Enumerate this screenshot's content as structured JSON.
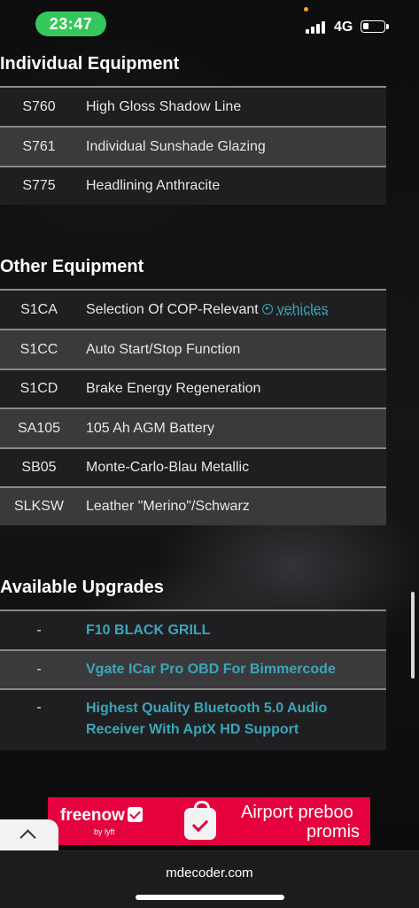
{
  "status_bar": {
    "time": "23:47",
    "network": "4G",
    "accent": "#34c759"
  },
  "sections": {
    "individual": {
      "title": "Individual Equipment",
      "rows": [
        {
          "code": "S760",
          "desc": "High Gloss Shadow Line"
        },
        {
          "code": "S761",
          "desc": "Individual Sunshade Glazing"
        },
        {
          "code": "S775",
          "desc": "Headlining Anthracite"
        }
      ]
    },
    "other": {
      "title": "Other Equipment",
      "rows": [
        {
          "code": "S1CA",
          "desc": "Selection Of COP-Relevant",
          "link": "vehicles"
        },
        {
          "code": "S1CC",
          "desc": "Auto Start/Stop Function"
        },
        {
          "code": "S1CD",
          "desc": "Brake Energy Regeneration"
        },
        {
          "code": "SA105",
          "desc": "105 Ah AGM Battery"
        },
        {
          "code": "SB05",
          "desc": "Monte-Carlo-Blau Metallic"
        },
        {
          "code": "SLKSW",
          "desc": "Leather \"Merino\"/Schwarz"
        }
      ]
    },
    "upgrades": {
      "title": "Available Upgrades",
      "rows": [
        {
          "code": "-",
          "desc": "F10 BLACK GRILL"
        },
        {
          "code": "-",
          "desc": "Vgate ICar Pro OBD For Bimmercode"
        },
        {
          "code": "-",
          "desc": "Highest Quality Bluetooth 5.0 Audio Receiver With AptX HD Support"
        }
      ]
    }
  },
  "ad": {
    "brand": "freenow",
    "brand_sub": "by lyft",
    "text_line1": "Airport preboo",
    "text_line2": "promis",
    "color": "#e5003e"
  },
  "browser": {
    "url": "mdecoder.com"
  },
  "colors": {
    "link": "#3aa6b9",
    "row_dark": "#1f1f21",
    "row_light": "#3a3a3d"
  }
}
